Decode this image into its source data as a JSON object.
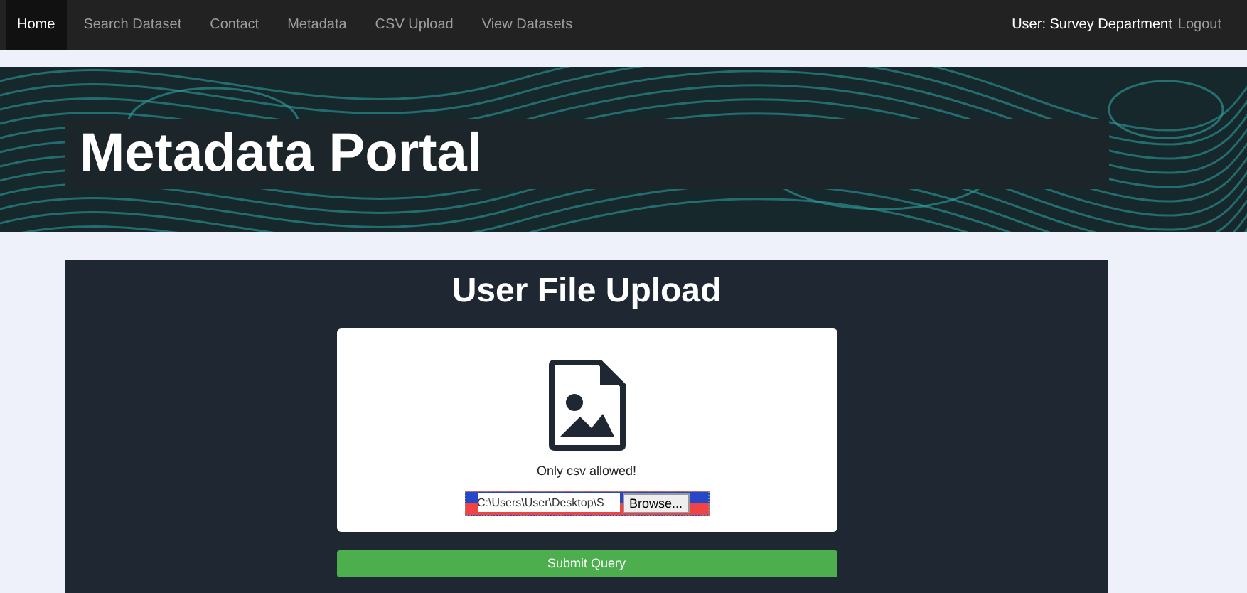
{
  "nav": {
    "items": [
      {
        "label": "Home",
        "selected": true
      },
      {
        "label": "Search Dataset",
        "selected": false
      },
      {
        "label": "Contact",
        "selected": false
      },
      {
        "label": "Metadata",
        "selected": false
      },
      {
        "label": "CSV Upload",
        "selected": false
      },
      {
        "label": "View Datasets",
        "selected": false
      }
    ],
    "user": "User: Survey Department",
    "logout": "Logout"
  },
  "banner": {
    "title": "Metadata Portal"
  },
  "upload": {
    "title": "User File Upload",
    "note": "Only csv allowed!",
    "file_value": "C:\\Users\\User\\Desktop\\S",
    "browse": "Browse...",
    "submit": "Submit Query"
  }
}
